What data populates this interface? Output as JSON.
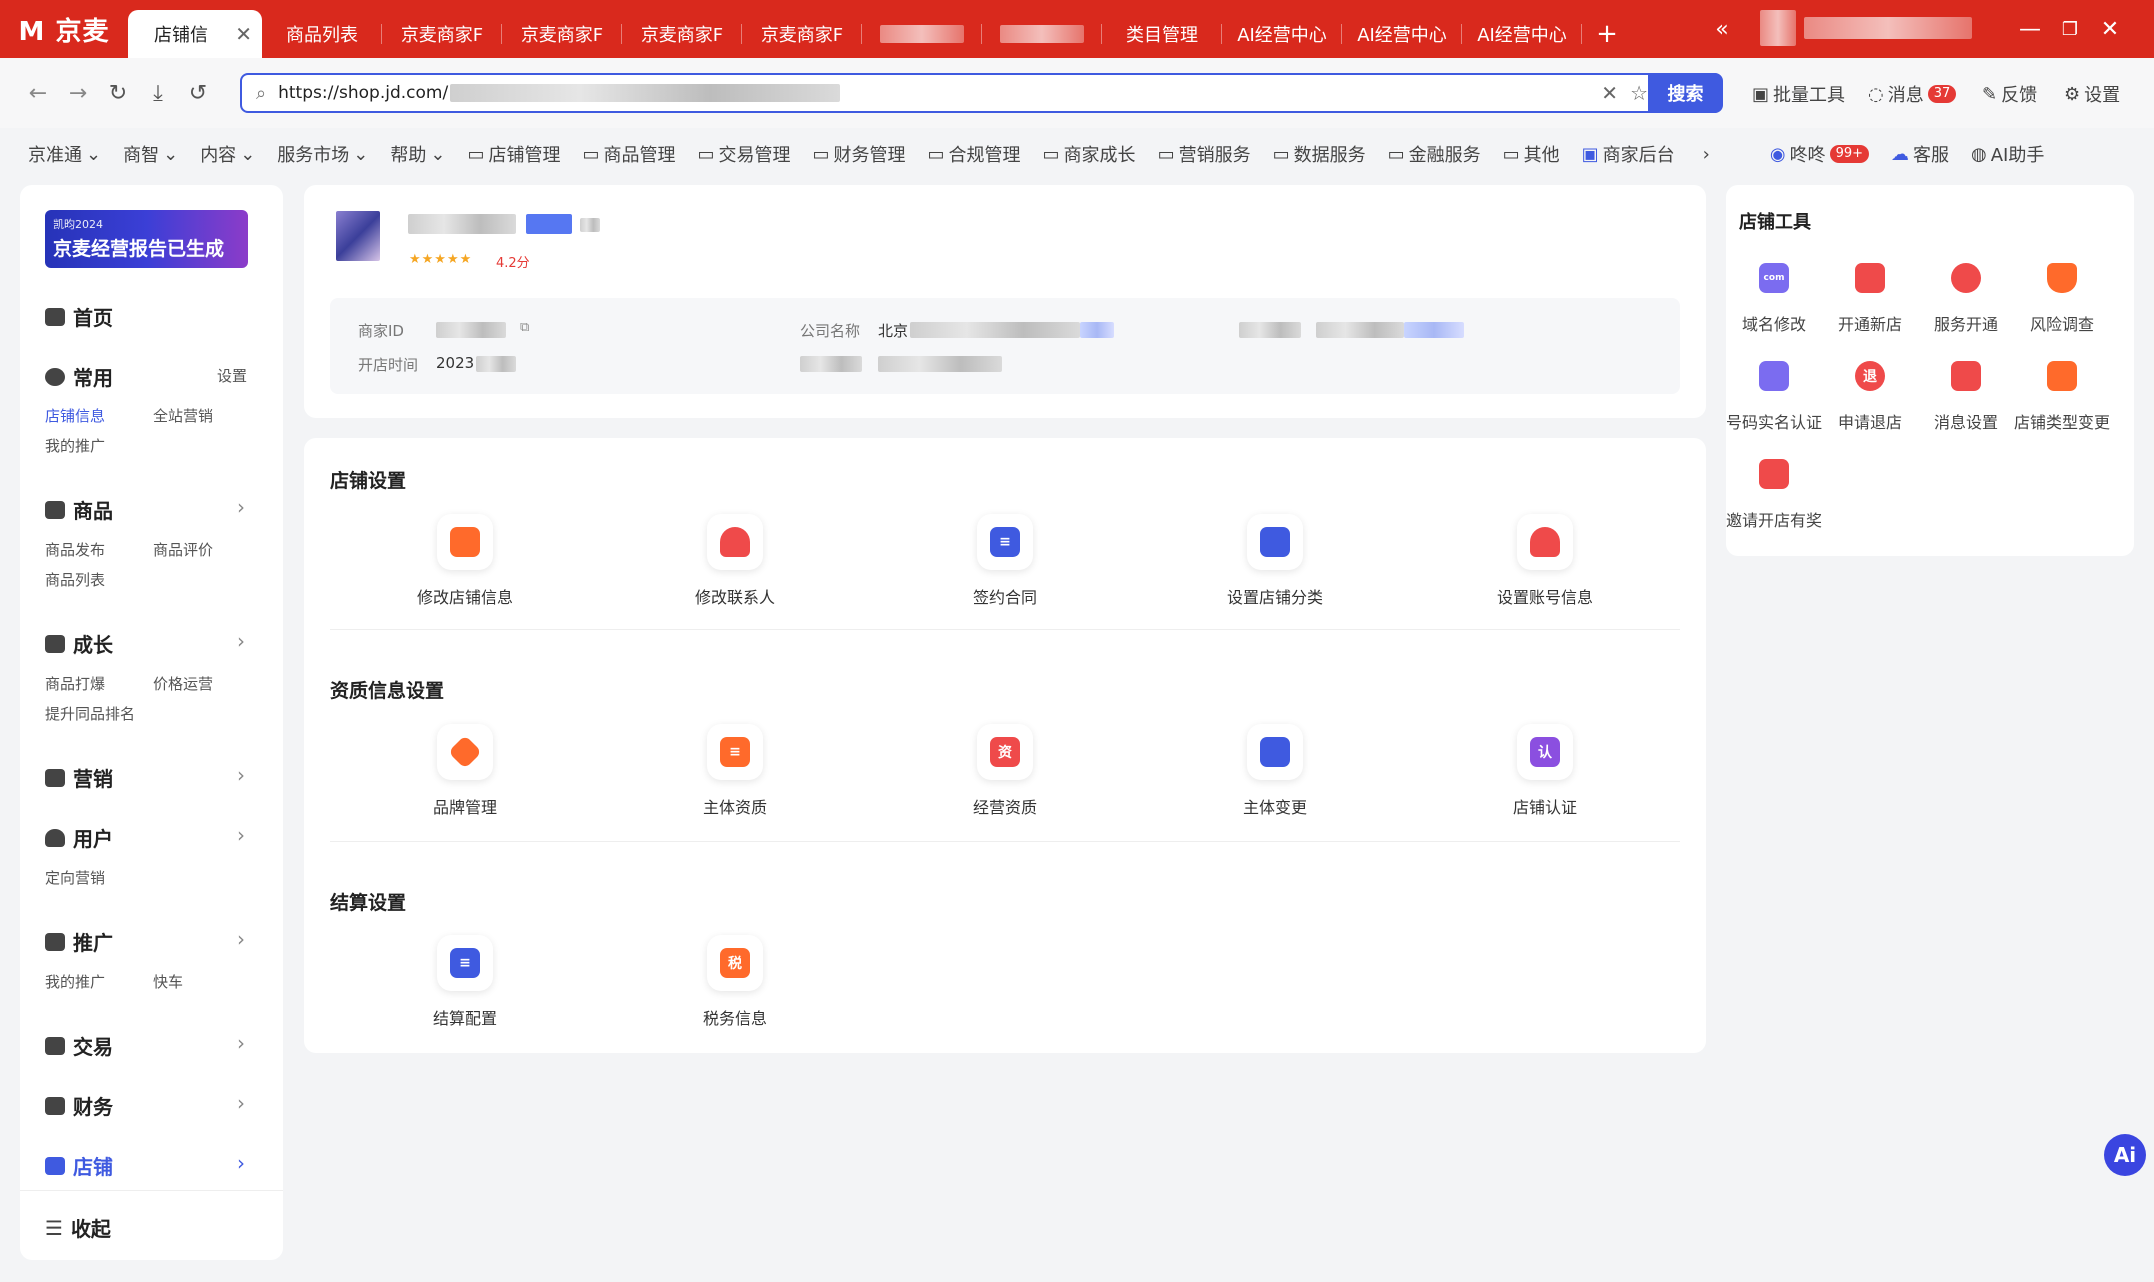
{
  "app": {
    "logo": "M 京麦"
  },
  "tabs": [
    {
      "label": "店铺信",
      "active": true
    },
    {
      "label": "商品列表"
    },
    {
      "label": "京麦商家F"
    },
    {
      "label": "京麦商家F"
    },
    {
      "label": "京麦商家F"
    },
    {
      "label": "京麦商家F"
    },
    {
      "label": "",
      "blurred": true
    },
    {
      "label": "",
      "blurred": true
    },
    {
      "label": "类目管理"
    },
    {
      "label": "AI经营中心"
    },
    {
      "label": "AI经营中心"
    },
    {
      "label": "AI经营中心"
    }
  ],
  "browser": {
    "url": "https://shop.jd.com/",
    "search_label": "搜索"
  },
  "right_tools": {
    "batch": "批量工具",
    "messages": "消息",
    "messages_count": "37",
    "feedback": "反馈",
    "settings": "设置"
  },
  "menu": {
    "dropdowns": [
      "京准通",
      "商智",
      "内容",
      "服务市场",
      "帮助"
    ],
    "items": [
      "店铺管理",
      "商品管理",
      "交易管理",
      "财务管理",
      "合规管理",
      "商家成长",
      "营销服务",
      "数据服务",
      "金融服务",
      "其他",
      "商家后台"
    ],
    "dongdong": "咚咚",
    "dongdong_badge": "99+",
    "service": "客服",
    "ai": "AI助手"
  },
  "sidebar": {
    "banner_small": "凯昀2024",
    "banner_main": "京麦经营报告已生成",
    "home": "首页",
    "common": "常用",
    "common_setting": "设置",
    "common_links": [
      "店铺信息",
      "全站营销",
      "我的推广"
    ],
    "product": "商品",
    "product_links": [
      "商品发布",
      "商品评价",
      "商品列表"
    ],
    "growth": "成长",
    "growth_links": [
      "商品打爆",
      "价格运营",
      "提升同品排名"
    ],
    "marketing": "营销",
    "user": "用户",
    "user_links": [
      "定向营销"
    ],
    "promotion": "推广",
    "promotion_links": [
      "我的推广",
      "快车"
    ],
    "trade": "交易",
    "finance": "财务",
    "shop": "店铺",
    "collapse": "收起"
  },
  "shop": {
    "rating": "4.2分",
    "id_label": "商家ID",
    "company_label": "公司名称",
    "company_prefix": "北京",
    "open_label": "开店时间",
    "open_value": "2023"
  },
  "sections": [
    {
      "title": "店铺设置",
      "items": [
        "修改店铺信息",
        "修改联系人",
        "签约合同",
        "设置店铺分类",
        "设置账号信息"
      ]
    },
    {
      "title": "资质信息设置",
      "items": [
        "品牌管理",
        "主体资质",
        "经营资质",
        "主体变更",
        "店铺认证"
      ]
    },
    {
      "title": "结算设置",
      "items": [
        "结算配置",
        "税务信息"
      ]
    }
  ],
  "tools": {
    "title": "店铺工具",
    "items": [
      "域名修改",
      "开通新店",
      "服务开通",
      "风险调查",
      "号码实名认证",
      "申请退店",
      "消息设置",
      "店铺类型变更",
      "邀请开店有奖"
    ]
  },
  "icons": {
    "tax_glyph": "税",
    "qual_glyph": "资",
    "cert_glyph": "认",
    "retreat_glyph": "退",
    "domain_glyph": "com",
    "fab": "Ai"
  },
  "colors": {
    "brand_red": "#d9291d",
    "accent_blue": "#3f5ae0",
    "orange": "#ff6a2b"
  }
}
